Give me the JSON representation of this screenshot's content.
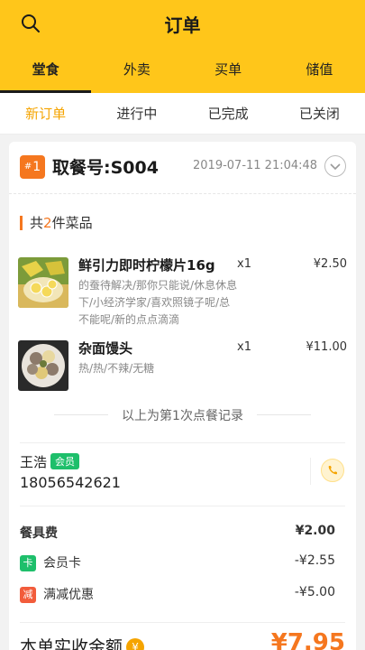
{
  "header": {
    "title": "订单",
    "search_icon": "search-icon",
    "tabs": [
      "堂食",
      "外卖",
      "买单",
      "储值"
    ],
    "active_tab": 0
  },
  "subtabs": {
    "items": [
      "新订单",
      "进行中",
      "已完成",
      "已关闭"
    ],
    "active": 0
  },
  "order": {
    "badge_hash": "#",
    "badge_number": "1",
    "pickup_label": "取餐号:S004",
    "time": "2019-07-11 21:04:48",
    "items_prefix": "共",
    "items_count": "2",
    "items_suffix": "件菜品",
    "dishes": [
      {
        "name": "鲜引力即时柠檬片16g",
        "desc": "的蚕待解决/那你只能说/休息休息下/小经济学家/喜欢照镜子呢/总不能呢/新的点点滴滴",
        "qty": "x1",
        "price": "¥2.50"
      },
      {
        "name": "杂面馒头",
        "desc": "热/热/不辣/无糖",
        "qty": "x1",
        "price": "¥11.00"
      }
    ],
    "round_note": "以上为第1次点餐记录",
    "customer": {
      "name": "王浩",
      "member_tag": "会员",
      "phone": "18056542621"
    },
    "fees": {
      "tableware_label": "餐具费",
      "tableware_value": "¥2.00",
      "member_icon_text": "卡",
      "member_label": "会员卡",
      "member_value": "-¥2.55",
      "discount_icon_text": "减",
      "discount_label": "满减优惠",
      "discount_value": "-¥5.00"
    },
    "total_label": "本单实收金额",
    "total_icon_text": "¥",
    "total_amount": "¥7.95"
  },
  "colors": {
    "brand_yellow": "#ffc61a",
    "accent_orange": "#f5771f",
    "active_subtab": "#f5a400",
    "member_green": "#1ebf6b",
    "discount_red": "#f25c3b"
  }
}
